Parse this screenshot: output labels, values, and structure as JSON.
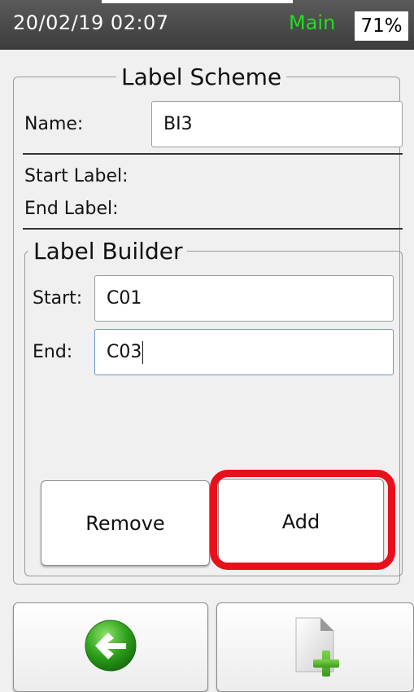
{
  "status_bar": {
    "datetime": "20/02/19 02:07",
    "mode": "Main",
    "battery": "71%"
  },
  "label_scheme": {
    "legend": "Label Scheme",
    "name_label": "Name:",
    "name_value": "BI3",
    "start_label": "Start Label:",
    "end_label": "End Label:"
  },
  "label_builder": {
    "legend": "Label Builder",
    "start_label": "Start:",
    "start_value": "C01",
    "end_label": "End:",
    "end_value": "C03"
  },
  "actions": {
    "remove_label": "Remove",
    "add_label": "Add"
  },
  "bottom_nav": {
    "back_icon": "back-arrow-icon",
    "new_icon": "new-document-plus-icon"
  },
  "colors": {
    "status_mode": "#22dd22",
    "highlight": "#e8101a",
    "back_icon_green": "#2fa21c"
  }
}
